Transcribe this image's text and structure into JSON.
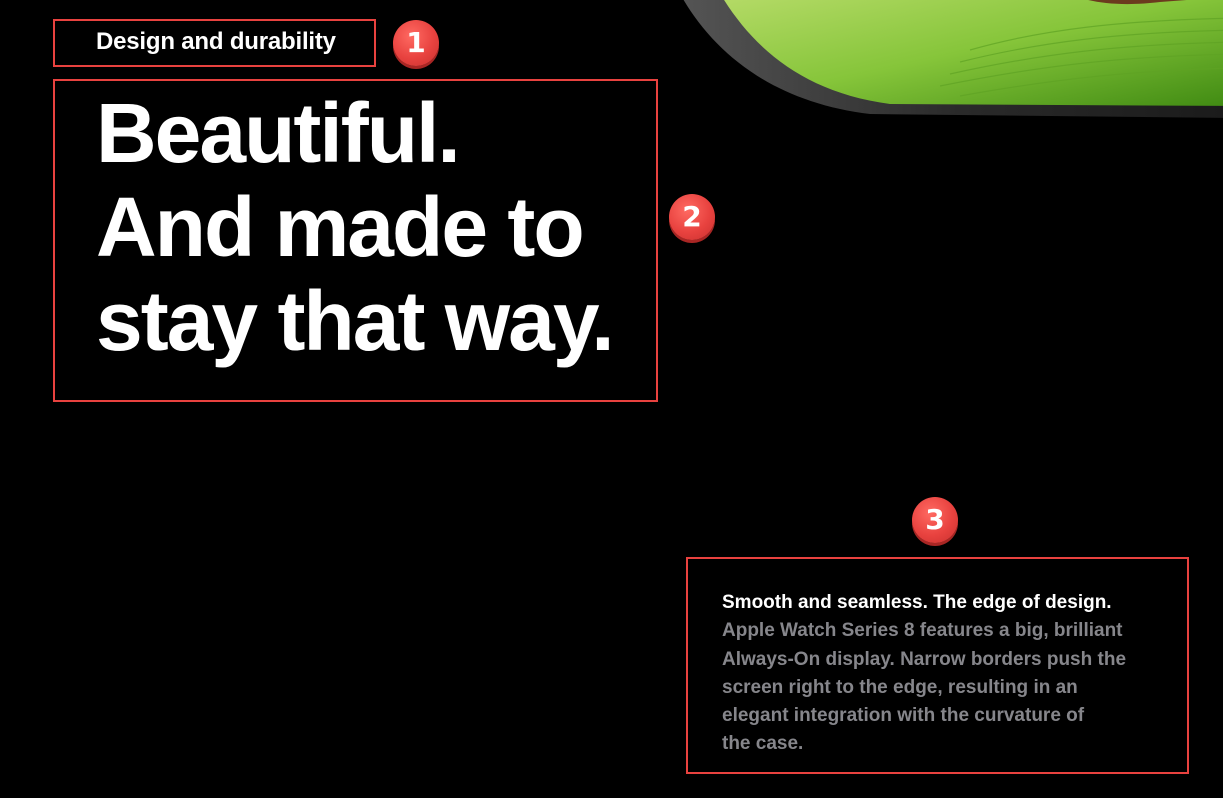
{
  "section": {
    "eyebrow": "Design and durability",
    "headline_lines": [
      "Beautiful.",
      "And made to",
      "stay that way."
    ]
  },
  "feature": {
    "title": "Smooth and seamless. The edge of design.",
    "body_lines": [
      "Apple Watch Series 8 features a big, brilliant",
      "Always-On display. Narrow borders push the",
      "screen right to the edge, resulting in an",
      "elegant integration with the curvature of",
      "the case."
    ]
  },
  "annotations": {
    "badge_1": "1",
    "badge_2": "2",
    "badge_3": "3"
  },
  "colors": {
    "background": "#000000",
    "annotation_red": "#e8423f",
    "body_gray": "#86868b"
  }
}
